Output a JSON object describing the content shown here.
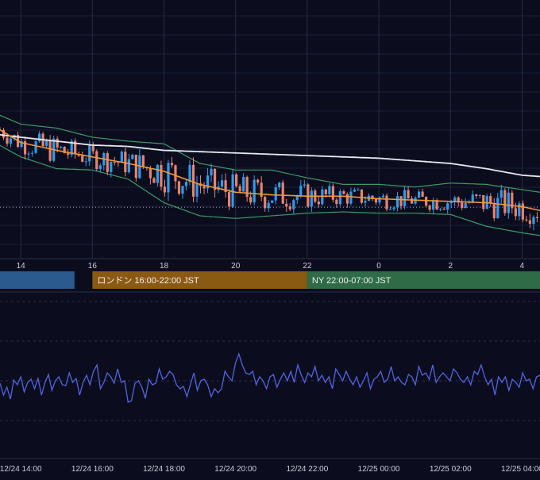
{
  "chart_data": [
    {
      "type": "candlestick",
      "title": "",
      "x_ticks": [
        "14",
        "16",
        "18",
        "20",
        "22",
        "0",
        "2",
        "4"
      ],
      "x_tick_hours": [
        14,
        16,
        18,
        20,
        22,
        24,
        26,
        28
      ],
      "x_range_hours": [
        13.42,
        28.5
      ],
      "price_range_norm": [
        0,
        1
      ],
      "reference_line_level": 0.265,
      "sessions": [
        {
          "label": "",
          "start_hour": 13.0,
          "end_hour": 15.5,
          "color": "#2a5a8e"
        },
        {
          "label": "ロンドン 16:00-22:00 JST",
          "start_hour": 16.0,
          "end_hour": 22.0,
          "color": "#8a5a12"
        },
        {
          "label": "NY 22:00-07:00 JST",
          "start_hour": 22.0,
          "end_hour": 28.5,
          "color": "#2e6b46"
        }
      ],
      "series": [
        {
          "kind": "moving_average_long",
          "color": "#e8e8ee",
          "points": [
            [
              13.4,
              0.82
            ],
            [
              14,
              0.8
            ],
            [
              15,
              0.77
            ],
            [
              16,
              0.74
            ],
            [
              17,
              0.73
            ],
            [
              18,
              0.7
            ],
            [
              19,
              0.69
            ],
            [
              20,
              0.68
            ],
            [
              22,
              0.66
            ],
            [
              24,
              0.64
            ],
            [
              25,
              0.62
            ],
            [
              26,
              0.6
            ],
            [
              27,
              0.56
            ],
            [
              28,
              0.51
            ],
            [
              28.5,
              0.5
            ]
          ]
        },
        {
          "kind": "moving_average_short",
          "color": "#f0983a",
          "points": [
            [
              13.4,
              0.86
            ],
            [
              14,
              0.76
            ],
            [
              15,
              0.7
            ],
            [
              16,
              0.65
            ],
            [
              17,
              0.6
            ],
            [
              18,
              0.54
            ],
            [
              19,
              0.44
            ],
            [
              20,
              0.38
            ],
            [
              21,
              0.36
            ],
            [
              22,
              0.35
            ],
            [
              23,
              0.35
            ],
            [
              24,
              0.33
            ],
            [
              25,
              0.32
            ],
            [
              26,
              0.31
            ],
            [
              27,
              0.3
            ],
            [
              28,
              0.27
            ],
            [
              28.5,
              0.24
            ]
          ]
        },
        {
          "kind": "bollinger_upper",
          "color": "#3f9a66",
          "points": [
            [
              13.4,
              0.97
            ],
            [
              14,
              0.9
            ],
            [
              15,
              0.87
            ],
            [
              16,
              0.8
            ],
            [
              17,
              0.77
            ],
            [
              18,
              0.75
            ],
            [
              19,
              0.6
            ],
            [
              20,
              0.55
            ],
            [
              21,
              0.55
            ],
            [
              22,
              0.49
            ],
            [
              23,
              0.44
            ],
            [
              24,
              0.44
            ],
            [
              25,
              0.42
            ],
            [
              26,
              0.45
            ],
            [
              27,
              0.44
            ],
            [
              28,
              0.4
            ],
            [
              28.5,
              0.38
            ]
          ]
        },
        {
          "kind": "bollinger_lower",
          "color": "#3f9a66",
          "points": [
            [
              13.4,
              0.74
            ],
            [
              14,
              0.65
            ],
            [
              15,
              0.56
            ],
            [
              16,
              0.55
            ],
            [
              17,
              0.48
            ],
            [
              18,
              0.3
            ],
            [
              19,
              0.2
            ],
            [
              20,
              0.18
            ],
            [
              21,
              0.2
            ],
            [
              22,
              0.22
            ],
            [
              23,
              0.23
            ],
            [
              24,
              0.22
            ],
            [
              25,
              0.22
            ],
            [
              26,
              0.21
            ],
            [
              27,
              0.12
            ],
            [
              28,
              0.07
            ],
            [
              28.5,
              0.05
            ]
          ]
        }
      ],
      "candle_colors": {
        "up": "#2f9be8",
        "down": "#e8826f"
      }
    },
    {
      "type": "line",
      "title": "",
      "x_ticks": [
        "12/24 14:00",
        "12/24 16:00",
        "12/24 18:00",
        "12/24 20:00",
        "12/24 22:00",
        "12/25 00:00",
        "12/25 02:00",
        "12/25 04:00"
      ],
      "y_range": [
        0,
        1
      ],
      "series": [
        {
          "color": "#5563e0",
          "values": [
            0.47,
            0.32,
            0.42,
            0.27,
            0.51,
            0.45,
            0.55,
            0.36,
            0.48,
            0.52,
            0.4,
            0.53,
            0.32,
            0.48,
            0.58,
            0.38,
            0.5,
            0.55,
            0.45,
            0.44,
            0.6,
            0.48,
            0.53,
            0.32,
            0.48,
            0.57,
            0.45,
            0.62,
            0.7,
            0.4,
            0.48,
            0.6,
            0.55,
            0.47,
            0.65,
            0.48,
            0.5,
            0.23,
            0.25,
            0.47,
            0.5,
            0.42,
            0.28,
            0.52,
            0.45,
            0.47,
            0.65,
            0.52,
            0.55,
            0.62,
            0.58,
            0.45,
            0.4,
            0.43,
            0.3,
            0.45,
            0.6,
            0.38,
            0.5,
            0.52,
            0.45,
            0.3,
            0.4,
            0.35,
            0.4,
            0.62,
            0.55,
            0.5,
            0.72,
            0.84,
            0.7,
            0.6,
            0.58,
            0.62,
            0.45,
            0.55,
            0.5,
            0.4,
            0.55,
            0.58,
            0.42,
            0.52,
            0.6,
            0.5,
            0.62,
            0.48,
            0.7,
            0.58,
            0.48,
            0.6,
            0.55,
            0.68,
            0.5,
            0.57,
            0.48,
            0.55,
            0.4,
            0.65,
            0.58,
            0.5,
            0.62,
            0.52,
            0.45,
            0.55,
            0.42,
            0.5,
            0.6,
            0.4,
            0.52,
            0.55,
            0.62,
            0.48,
            0.52,
            0.68,
            0.5,
            0.55,
            0.48,
            0.45,
            0.58,
            0.55,
            0.45,
            0.68,
            0.57,
            0.6,
            0.52,
            0.7,
            0.48,
            0.55,
            0.6,
            0.55,
            0.5,
            0.65,
            0.6,
            0.52,
            0.48,
            0.55,
            0.45,
            0.62,
            0.58,
            0.7,
            0.55,
            0.45,
            0.52,
            0.32,
            0.55,
            0.48,
            0.55,
            0.38,
            0.52,
            0.48,
            0.42,
            0.6,
            0.5,
            0.52,
            0.4,
            0.55,
            0.57
          ]
        }
      ]
    }
  ]
}
